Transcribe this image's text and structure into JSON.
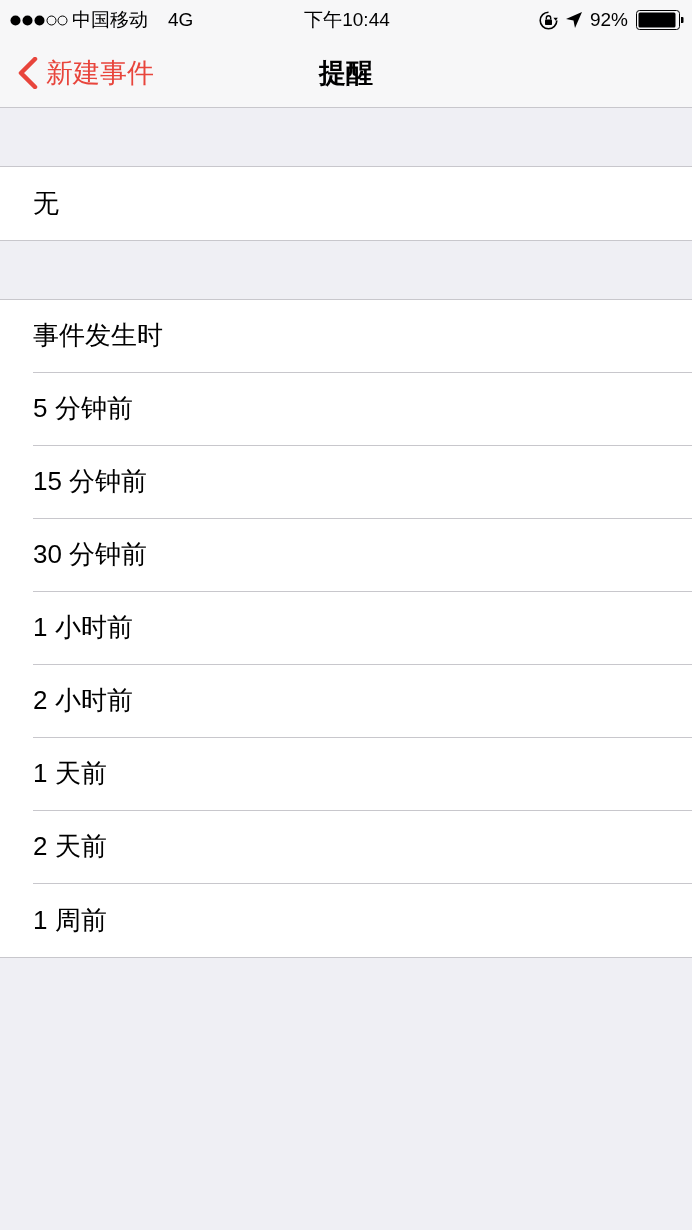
{
  "status_bar": {
    "carrier": "中国移动",
    "network": "4G",
    "time": "下午10:44",
    "battery": "92%"
  },
  "nav_bar": {
    "back_label": "新建事件",
    "title": "提醒"
  },
  "sections": [
    {
      "items": [
        {
          "label": "无"
        }
      ]
    },
    {
      "items": [
        {
          "label": "事件发生时"
        },
        {
          "label": "5 分钟前"
        },
        {
          "label": "15 分钟前"
        },
        {
          "label": "30 分钟前"
        },
        {
          "label": "1 小时前"
        },
        {
          "label": "2 小时前"
        },
        {
          "label": "1 天前"
        },
        {
          "label": "2 天前"
        },
        {
          "label": "1 周前"
        }
      ]
    }
  ]
}
